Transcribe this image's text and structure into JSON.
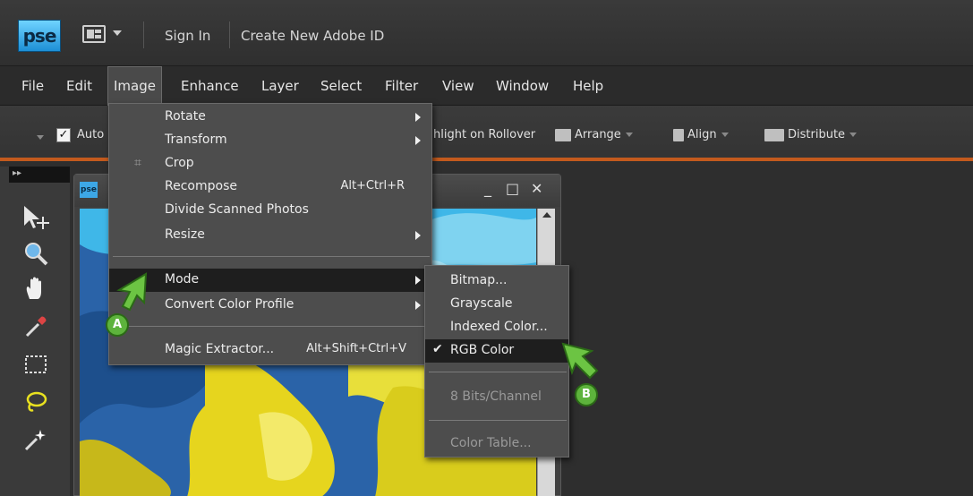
{
  "app": {
    "logo_text": "pse",
    "sign_in": "Sign In",
    "create_id": "Create New Adobe ID",
    "accent_color": "#c35a1d"
  },
  "menubar": {
    "items": [
      "File",
      "Edit",
      "Image",
      "Enhance",
      "Layer",
      "Select",
      "Filter",
      "View",
      "Window",
      "Help"
    ],
    "active": "Image"
  },
  "options": {
    "auto_label": "Auto",
    "highlight_label": "hlight on Rollover",
    "arrange_label": "Arrange",
    "align_label": "Align",
    "distribute_label": "Distribute"
  },
  "tools": {
    "panel_toggle": "▸▸",
    "icons": [
      "move-icon",
      "zoom-icon",
      "hand-icon",
      "eyedropper-icon",
      "marquee-icon",
      "lasso-icon",
      "magic-wand-icon"
    ]
  },
  "document": {
    "badge": "pse",
    "minimize": "_",
    "maximize": "□",
    "close": "✕"
  },
  "image_menu": {
    "rotate": "Rotate",
    "transform": "Transform",
    "crop": "Crop",
    "recompose": "Recompose",
    "recompose_shortcut": "Alt+Ctrl+R",
    "divide": "Divide Scanned Photos",
    "resize": "Resize",
    "mode": "Mode",
    "convert": "Convert Color Profile",
    "magic": "Magic Extractor...",
    "magic_shortcut": "Alt+Shift+Ctrl+V"
  },
  "mode_submenu": {
    "bitmap": "Bitmap...",
    "grayscale": "Grayscale",
    "indexed": "Indexed Color...",
    "rgb": "RGB Color",
    "bits": "8 Bits/Channel",
    "color_table": "Color Table...",
    "checked_mark": "✔"
  },
  "callouts": {
    "a": "A",
    "b": "B",
    "color": "#5db33c"
  }
}
